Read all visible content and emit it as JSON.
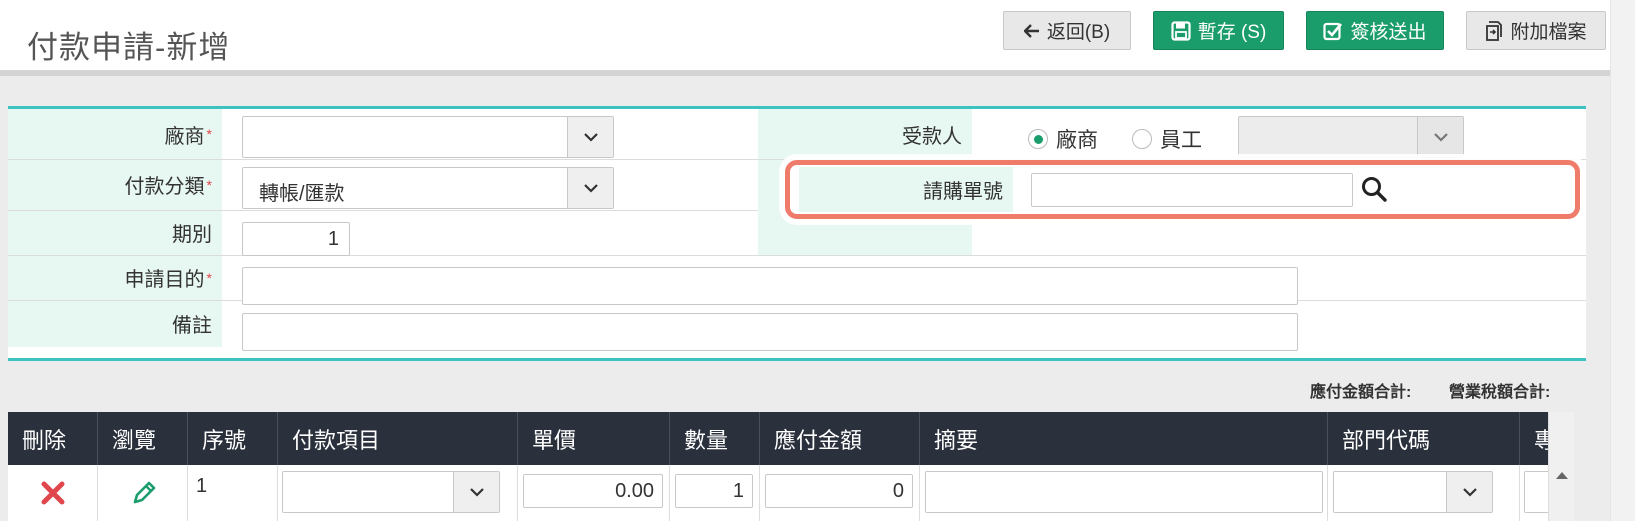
{
  "header": {
    "title": "付款申請-新增",
    "back_label": "返回(B)",
    "save_label": "暫存 (S)",
    "submit_label": "簽核送出",
    "attach_label": "附加檔案"
  },
  "form": {
    "vendor_label": "廠商",
    "payment_category_label": "付款分類",
    "payment_category_value": "轉帳/匯款",
    "period_label": "期別",
    "period_value": "1",
    "purpose_label": "申請目的",
    "remark_label": "備註",
    "payee_label": "受款人",
    "payee_options": [
      "廠商",
      "員工"
    ],
    "payee_selected": "廠商",
    "required_mark": "*",
    "pr_number_label": "請購單號"
  },
  "totals": {
    "payable_total_label": "應付金額合計:",
    "tax_total_label": "營業稅額合計:"
  },
  "grid": {
    "columns": [
      "刪除",
      "瀏覽",
      "序號",
      "付款項目",
      "單價",
      "數量",
      "應付金額",
      "摘要",
      "部門代碼",
      "專"
    ],
    "rows": [
      {
        "seq": "1",
        "unit_price": "0.00",
        "quantity": "1",
        "amount": "0"
      }
    ]
  },
  "colors": {
    "accent_green": "#1a9d6a",
    "teal_border": "#3cc3c0",
    "highlight": "#ef7b6a",
    "label_bg": "#e7f7f1",
    "grid_header": "#2a303c",
    "delete_red": "#e0474c"
  },
  "icons": {
    "back": "arrow-left-icon",
    "save": "floppy-disk-icon",
    "submit": "check-square-icon",
    "attach": "attach-file-icon",
    "search": "search-icon",
    "dropdown": "chevron-down-icon",
    "delete": "x-mark-icon",
    "edit": "pencil-icon"
  }
}
